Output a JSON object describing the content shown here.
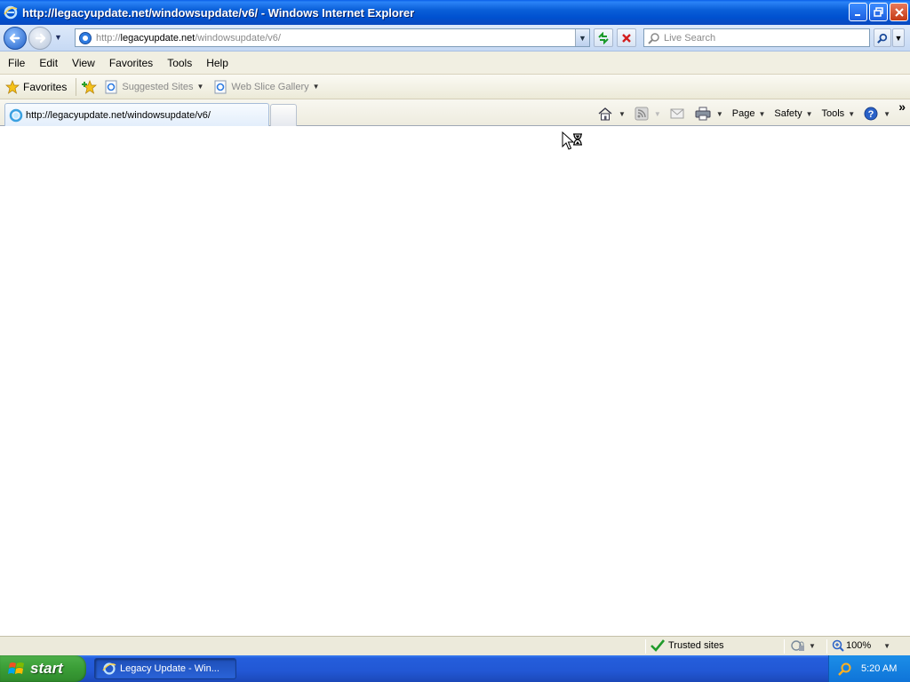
{
  "window": {
    "title": "http://legacyupdate.net/windowsupdate/v6/ - Windows Internet Explorer"
  },
  "address": {
    "url_scheme": "http://",
    "url_host": "legacyupdate.net",
    "url_path": "/windowsupdate/v6/"
  },
  "search": {
    "placeholder": "Live Search"
  },
  "menu": [
    "File",
    "Edit",
    "View",
    "Favorites",
    "Tools",
    "Help"
  ],
  "favorites_bar": {
    "favorites_label": "Favorites",
    "suggested_sites": "Suggested Sites",
    "web_slice_gallery": "Web Slice Gallery"
  },
  "tab": {
    "label": "http://legacyupdate.net/windowsupdate/v6/"
  },
  "command_bar": {
    "page": "Page",
    "safety": "Safety",
    "tools": "Tools"
  },
  "status": {
    "zone": "Trusted sites",
    "zoom": "100%"
  },
  "taskbar": {
    "start_label": "start",
    "task_item": "Legacy Update - Win...",
    "clock": "5:20 AM"
  },
  "colors": {
    "titlebar": "#0a5fd8",
    "taskbar": "#245edc",
    "start_button": "#3a9d36",
    "tray": "#0f74d8"
  },
  "icons": {
    "app": "ie-icon",
    "back": "back-arrow-icon",
    "forward": "forward-arrow-icon",
    "refresh": "refresh-icon",
    "stop": "stop-icon",
    "search": "magnifier-icon",
    "home": "home-icon",
    "feeds": "rss-feed-icon",
    "mail": "mail-icon",
    "print": "printer-icon",
    "help": "help-icon",
    "cursor": "busy-cursor-icon"
  }
}
